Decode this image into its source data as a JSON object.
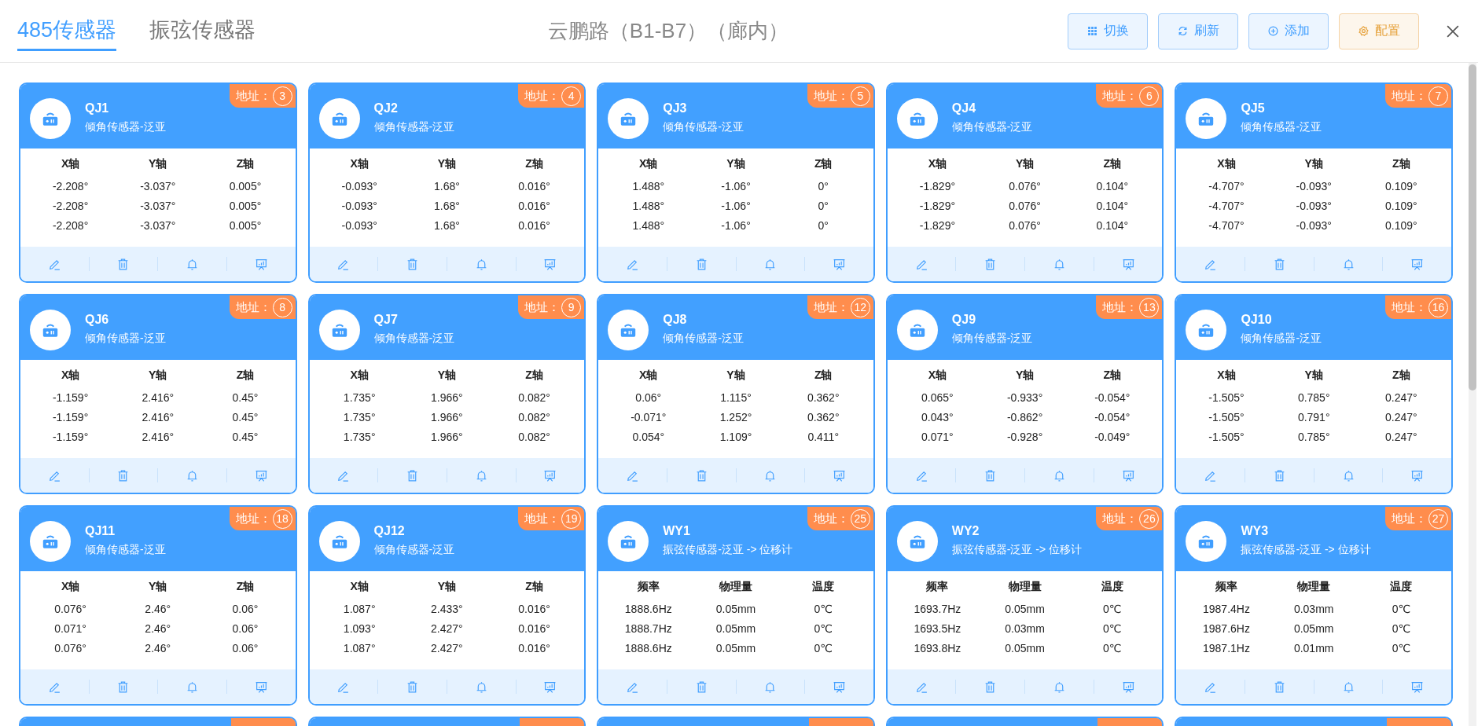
{
  "tabs": [
    {
      "label": "485传感器",
      "selected": true
    },
    {
      "label": "振弦传感器",
      "selected": false
    }
  ],
  "title": "云鹏路（B1-B7）（廊内）",
  "buttons": [
    {
      "label": "切换",
      "kind": "switch"
    },
    {
      "label": "刷新",
      "kind": "refresh"
    },
    {
      "label": "添加",
      "kind": "add"
    },
    {
      "label": "配置",
      "kind": "config"
    }
  ],
  "cards": [
    {
      "name": "QJ1",
      "type": "倾角传感器-泛亚",
      "address_label": "地址：",
      "address": "3",
      "columns": [
        "X轴",
        "Y轴",
        "Z轴"
      ],
      "rows": [
        [
          "-2.208°",
          "-3.037°",
          "0.005°"
        ],
        [
          "-2.208°",
          "-3.037°",
          "0.005°"
        ],
        [
          "-2.208°",
          "-3.037°",
          "0.005°"
        ]
      ]
    },
    {
      "name": "QJ2",
      "type": "倾角传感器-泛亚",
      "address_label": "地址：",
      "address": "4",
      "columns": [
        "X轴",
        "Y轴",
        "Z轴"
      ],
      "rows": [
        [
          "-0.093°",
          "1.68°",
          "0.016°"
        ],
        [
          "-0.093°",
          "1.68°",
          "0.016°"
        ],
        [
          "-0.093°",
          "1.68°",
          "0.016°"
        ]
      ]
    },
    {
      "name": "QJ3",
      "type": "倾角传感器-泛亚",
      "address_label": "地址：",
      "address": "5",
      "columns": [
        "X轴",
        "Y轴",
        "Z轴"
      ],
      "rows": [
        [
          "1.488°",
          "-1.06°",
          "0°"
        ],
        [
          "1.488°",
          "-1.06°",
          "0°"
        ],
        [
          "1.488°",
          "-1.06°",
          "0°"
        ]
      ]
    },
    {
      "name": "QJ4",
      "type": "倾角传感器-泛亚",
      "address_label": "地址：",
      "address": "6",
      "columns": [
        "X轴",
        "Y轴",
        "Z轴"
      ],
      "rows": [
        [
          "-1.829°",
          "0.076°",
          "0.104°"
        ],
        [
          "-1.829°",
          "0.076°",
          "0.104°"
        ],
        [
          "-1.829°",
          "0.076°",
          "0.104°"
        ]
      ]
    },
    {
      "name": "QJ5",
      "type": "倾角传感器-泛亚",
      "address_label": "地址：",
      "address": "7",
      "columns": [
        "X轴",
        "Y轴",
        "Z轴"
      ],
      "rows": [
        [
          "-4.707°",
          "-0.093°",
          "0.109°"
        ],
        [
          "-4.707°",
          "-0.093°",
          "0.109°"
        ],
        [
          "-4.707°",
          "-0.093°",
          "0.109°"
        ]
      ]
    },
    {
      "name": "QJ6",
      "type": "倾角传感器-泛亚",
      "address_label": "地址：",
      "address": "8",
      "columns": [
        "X轴",
        "Y轴",
        "Z轴"
      ],
      "rows": [
        [
          "-1.159°",
          "2.416°",
          "0.45°"
        ],
        [
          "-1.159°",
          "2.416°",
          "0.45°"
        ],
        [
          "-1.159°",
          "2.416°",
          "0.45°"
        ]
      ]
    },
    {
      "name": "QJ7",
      "type": "倾角传感器-泛亚",
      "address_label": "地址：",
      "address": "9",
      "columns": [
        "X轴",
        "Y轴",
        "Z轴"
      ],
      "rows": [
        [
          "1.735°",
          "1.966°",
          "0.082°"
        ],
        [
          "1.735°",
          "1.966°",
          "0.082°"
        ],
        [
          "1.735°",
          "1.966°",
          "0.082°"
        ]
      ]
    },
    {
      "name": "QJ8",
      "type": "倾角传感器-泛亚",
      "address_label": "地址：",
      "address": "12",
      "columns": [
        "X轴",
        "Y轴",
        "Z轴"
      ],
      "rows": [
        [
          "0.06°",
          "1.115°",
          "0.362°"
        ],
        [
          "-0.071°",
          "1.252°",
          "0.362°"
        ],
        [
          "0.054°",
          "1.109°",
          "0.411°"
        ]
      ]
    },
    {
      "name": "QJ9",
      "type": "倾角传感器-泛亚",
      "address_label": "地址：",
      "address": "13",
      "columns": [
        "X轴",
        "Y轴",
        "Z轴"
      ],
      "rows": [
        [
          "0.065°",
          "-0.933°",
          "-0.054°"
        ],
        [
          "0.043°",
          "-0.862°",
          "-0.054°"
        ],
        [
          "0.071°",
          "-0.928°",
          "-0.049°"
        ]
      ]
    },
    {
      "name": "QJ10",
      "type": "倾角传感器-泛亚",
      "address_label": "地址：",
      "address": "16",
      "columns": [
        "X轴",
        "Y轴",
        "Z轴"
      ],
      "rows": [
        [
          "-1.505°",
          "0.785°",
          "0.247°"
        ],
        [
          "-1.505°",
          "0.791°",
          "0.247°"
        ],
        [
          "-1.505°",
          "0.785°",
          "0.247°"
        ]
      ]
    },
    {
      "name": "QJ11",
      "type": "倾角传感器-泛亚",
      "address_label": "地址：",
      "address": "18",
      "columns": [
        "X轴",
        "Y轴",
        "Z轴"
      ],
      "rows": [
        [
          "0.076°",
          "2.46°",
          "0.06°"
        ],
        [
          "0.071°",
          "2.46°",
          "0.06°"
        ],
        [
          "0.076°",
          "2.46°",
          "0.06°"
        ]
      ]
    },
    {
      "name": "QJ12",
      "type": "倾角传感器-泛亚",
      "address_label": "地址：",
      "address": "19",
      "columns": [
        "X轴",
        "Y轴",
        "Z轴"
      ],
      "rows": [
        [
          "1.087°",
          "2.433°",
          "0.016°"
        ],
        [
          "1.093°",
          "2.427°",
          "0.016°"
        ],
        [
          "1.087°",
          "2.427°",
          "0.016°"
        ]
      ]
    },
    {
      "name": "WY1",
      "type": "振弦传感器-泛亚 -> 位移计",
      "address_label": "地址：",
      "address": "25",
      "columns": [
        "频率",
        "物理量",
        "温度"
      ],
      "rows": [
        [
          "1888.6Hz",
          "0.05mm",
          "0℃"
        ],
        [
          "1888.7Hz",
          "0.05mm",
          "0℃"
        ],
        [
          "1888.6Hz",
          "0.05mm",
          "0℃"
        ]
      ]
    },
    {
      "name": "WY2",
      "type": "振弦传感器-泛亚 -> 位移计",
      "address_label": "地址：",
      "address": "26",
      "columns": [
        "频率",
        "物理量",
        "温度"
      ],
      "rows": [
        [
          "1693.7Hz",
          "0.05mm",
          "0℃"
        ],
        [
          "1693.5Hz",
          "0.03mm",
          "0℃"
        ],
        [
          "1693.8Hz",
          "0.05mm",
          "0℃"
        ]
      ]
    },
    {
      "name": "WY3",
      "type": "振弦传感器-泛亚 -> 位移计",
      "address_label": "地址：",
      "address": "27",
      "columns": [
        "频率",
        "物理量",
        "温度"
      ],
      "rows": [
        [
          "1987.4Hz",
          "0.03mm",
          "0℃"
        ],
        [
          "1987.6Hz",
          "0.05mm",
          "0℃"
        ],
        [
          "1987.1Hz",
          "0.01mm",
          "0℃"
        ]
      ]
    }
  ]
}
